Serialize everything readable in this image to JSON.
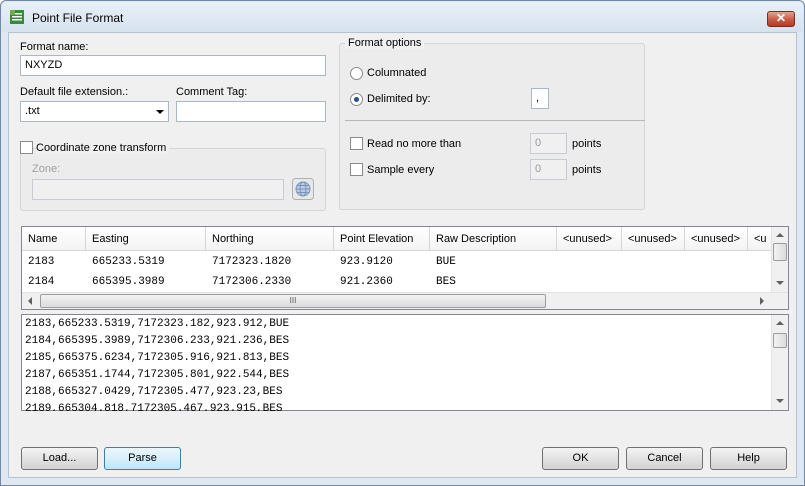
{
  "window": {
    "title": "Point File Format",
    "close_glyph": "✕"
  },
  "format_name": {
    "label": "Format name:",
    "value": "NXYZD"
  },
  "file_extension": {
    "label": "Default file extension.:",
    "value": ".txt"
  },
  "comment_tag": {
    "label": "Comment Tag:",
    "value": ""
  },
  "coordinate_zone": {
    "checkbox_label": "Coordinate zone transform",
    "zone_label": "Zone:",
    "zone_value": "",
    "checked": false
  },
  "format_options": {
    "title": "Format options",
    "columnated_label": "Columnated",
    "delimited_label": "Delimited by:",
    "delimiter_value": ",",
    "selected": "Delimited by:",
    "read_no_more_label": "Read no more than",
    "read_no_more_value": "0",
    "read_no_more_unit": "points",
    "sample_every_label": "Sample every",
    "sample_every_value": "0",
    "sample_every_unit": "points"
  },
  "columns_table": {
    "headers": [
      "Name",
      "Easting",
      "Northing",
      "Point Elevation",
      "Raw Description",
      "<unused>",
      "<unused>",
      "<unused>",
      "<u"
    ],
    "rows": [
      [
        "2183",
        "665233.5319",
        "7172323.1820",
        "923.9120",
        "BUE"
      ],
      [
        "2184",
        "665395.3989",
        "7172306.2330",
        "921.2360",
        "BES"
      ]
    ],
    "scroll_grip": "III"
  },
  "raw_text": {
    "lines": [
      "2183,665233.5319,7172323.182,923.912,BUE",
      "2184,665395.3989,7172306.233,921.236,BES",
      "2185,665375.6234,7172305.916,921.813,BES",
      "2187,665351.1744,7172305.801,922.544,BES",
      "2188,665327.0429,7172305.477,923.23,BES",
      "2189,665304.818,7172305.467,923.915,BES"
    ]
  },
  "buttons": {
    "load": "Load...",
    "parse": "Parse",
    "ok": "OK",
    "cancel": "Cancel",
    "help": "Help"
  },
  "colors": {
    "title_bar": "#dfe8f1",
    "close_button": "#c85a45",
    "client_background": "#f0f0f0"
  },
  "icons": [
    "app-icon",
    "close-icon",
    "globe-icon",
    "chevron-down-icon",
    "arrow-up-icon",
    "arrow-down-icon",
    "arrow-left-icon",
    "arrow-right-icon"
  ]
}
